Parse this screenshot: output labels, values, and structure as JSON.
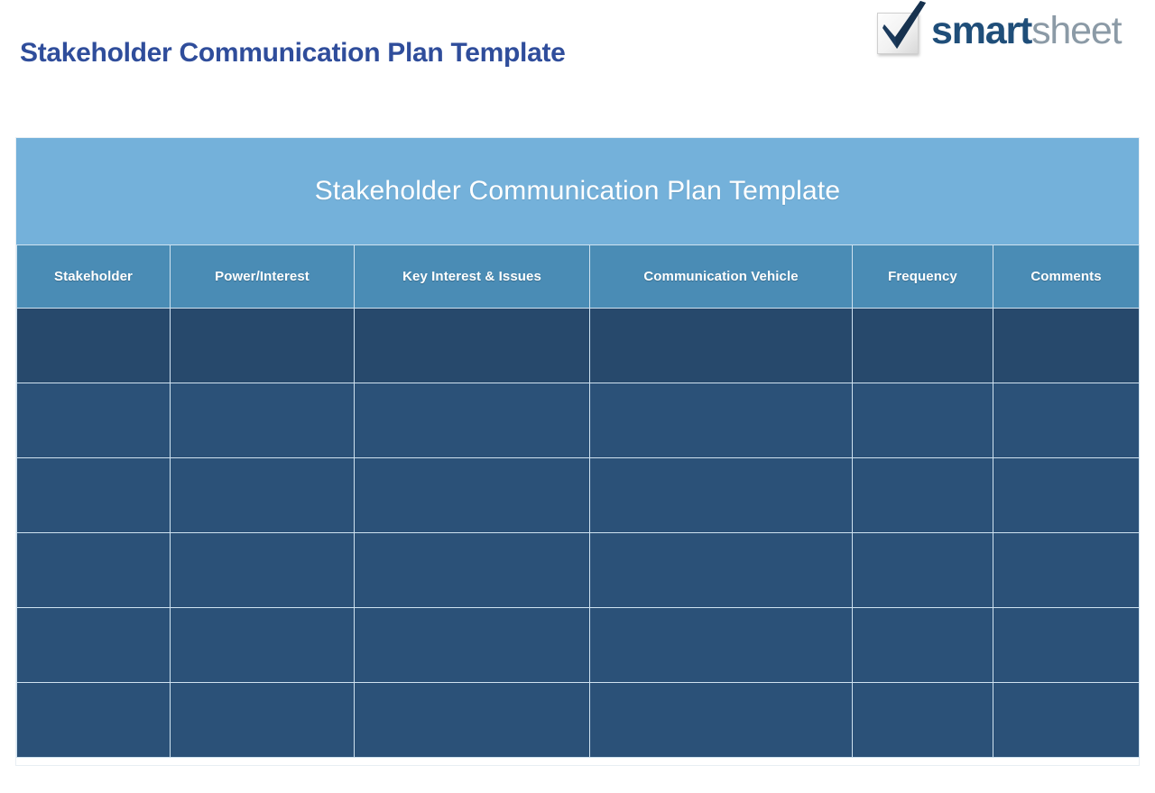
{
  "page": {
    "title": "Stakeholder Communication Plan Template",
    "title_color": "#2f4d9b",
    "background_color": "#ffffff"
  },
  "brand": {
    "logo_name": "smartsheet-logo",
    "wordmark_primary": "smart",
    "wordmark_secondary": "sheet",
    "check_icon": "checkmark-icon",
    "primary_color": "#1f4e79",
    "secondary_color": "#8b9aa6"
  },
  "table": {
    "banner_title": "Stakeholder Communication Plan Template",
    "banner_color": "#74b1da",
    "header_color": "#4a8cb5",
    "body_color": "#2b5178",
    "first_row_color": "#27496c",
    "gridline_color": "#cfe2f0",
    "columns": [
      {
        "label": "Stakeholder"
      },
      {
        "label": "Power/Interest"
      },
      {
        "label": "Key Interest & Issues"
      },
      {
        "label": "Communication Vehicle"
      },
      {
        "label": "Frequency"
      },
      {
        "label": "Comments"
      }
    ],
    "rows": [
      {
        "cells": [
          "",
          "",
          "",
          "",
          "",
          ""
        ]
      },
      {
        "cells": [
          "",
          "",
          "",
          "",
          "",
          ""
        ]
      },
      {
        "cells": [
          "",
          "",
          "",
          "",
          "",
          ""
        ]
      },
      {
        "cells": [
          "",
          "",
          "",
          "",
          "",
          ""
        ]
      },
      {
        "cells": [
          "",
          "",
          "",
          "",
          "",
          ""
        ]
      },
      {
        "cells": [
          "",
          "",
          "",
          "",
          "",
          ""
        ]
      }
    ]
  }
}
